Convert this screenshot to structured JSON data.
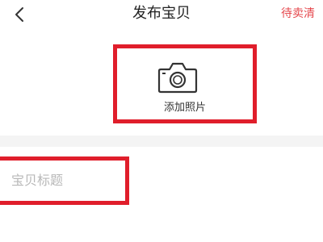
{
  "header": {
    "title": "发布宝贝",
    "draft_label": "待卖清",
    "back_icon": "chevron-left-icon"
  },
  "photo": {
    "label": "添加照片",
    "icon": "camera-icon"
  },
  "form": {
    "title_placeholder": "宝贝标题",
    "title_value": ""
  },
  "colors": {
    "accent": "#e5484d",
    "highlight": "#e01e2b",
    "divider": "#f4f4f4"
  }
}
